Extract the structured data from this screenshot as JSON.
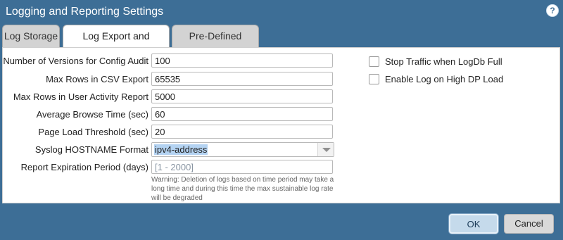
{
  "window": {
    "title": "Logging and Reporting Settings",
    "help_glyph": "?"
  },
  "tabs": [
    {
      "label": "Log Storage",
      "active": false
    },
    {
      "label": "Log Export and Reporting",
      "active": true
    },
    {
      "label": "Pre-Defined Reports",
      "active": false
    }
  ],
  "form": {
    "config_audit_versions": {
      "label": "Number of Versions for Config Audit",
      "value": "100"
    },
    "csv_max_rows": {
      "label": "Max Rows in CSV Export",
      "value": "65535"
    },
    "user_activity_max_rows": {
      "label": "Max Rows in User Activity Report",
      "value": "5000"
    },
    "avg_browse_time": {
      "label": "Average Browse Time (sec)",
      "value": "60"
    },
    "page_load_threshold": {
      "label": "Page Load Threshold (sec)",
      "value": "20"
    },
    "syslog_hostname_format": {
      "label": "Syslog HOSTNAME Format",
      "value": "ipv4-address"
    },
    "report_expiration": {
      "label": "Report Expiration Period (days)",
      "value": "",
      "placeholder": "[1 - 2000]"
    },
    "warning": "Warning: Deletion of logs based on time period may take a long time and during this time the max sustainable log rate will be degraded"
  },
  "options": {
    "stop_traffic_logdb_full": {
      "label": "Stop Traffic when LogDb Full",
      "checked": false
    },
    "log_high_dp_load": {
      "label": "Enable Log on High DP Load",
      "checked": false
    }
  },
  "buttons": {
    "ok": "OK",
    "cancel": "Cancel"
  },
  "colors": {
    "window_bg": "#3d6e96",
    "selection": "#b4d3f2",
    "ok_button": "#c5daeb"
  }
}
